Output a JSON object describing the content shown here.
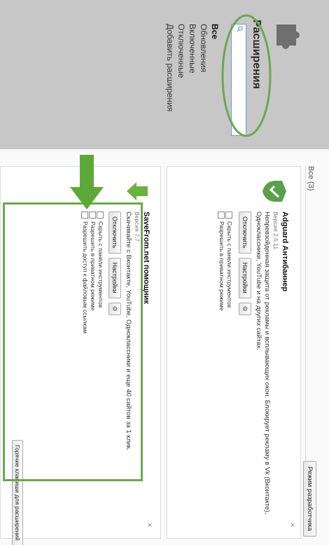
{
  "sidebar": {
    "title": "Расширения",
    "nav": [
      "Все",
      "Обновления",
      "Включенные",
      "Отключенные",
      "Добавить расширения"
    ]
  },
  "main": {
    "tab_all": "Все (3)",
    "dev_mode_label": "Режим разработчика"
  },
  "extensions": [
    {
      "name": "Adguard Антибаннер",
      "version": "Версия 2.5.11",
      "description": [
        "Непревзойденная защита от рекламы и всплывающих окон. Блокирует рекламу в Vk (Вконтакте),",
        "Одноклассники, YouTube и на других сайтах."
      ],
      "disable_label": "Отключить",
      "settings_label": "Настройки",
      "options": [
        "Скрыть с панели инструментов",
        "Разрешить в приватном режиме"
      ],
      "close_symbol": "×"
    },
    {
      "name": "SaveFrom.net помощник",
      "version": "Версия 7.7",
      "description": [
        "Скачивайте с Вконтакте, YouTube, Одноклассники и еще 40 сайтов за 1 клик."
      ],
      "disable_label": "Отключить",
      "settings_label": "Настройки",
      "options": [
        "Скрыть с панели инструментов",
        "Разрешить в приватном режиме",
        "Разрешить доступ к файловым ссылкам"
      ],
      "hotkeys_label": "Горячие клавиши для расширений",
      "close_symbol": "×"
    }
  ],
  "colors": {
    "sidebar_bg": "#c7c7c7",
    "accent_green": "#6aa84f",
    "highlight_green": "#5ea83a",
    "search_border": "#6e9bd6"
  },
  "icons": {
    "sidebar": "puzzle-icon",
    "adguard": "adguard-shield-icon",
    "savefrom": "savefrom-arrow-icon",
    "gear": "gear-icon",
    "search": "search-icon"
  }
}
